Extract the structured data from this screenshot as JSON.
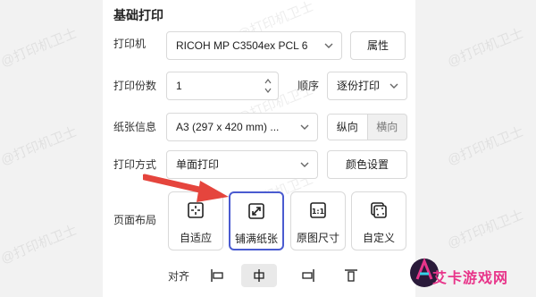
{
  "watermark": "@打印机卫士",
  "section_title": "基础打印",
  "printer": {
    "label": "打印机",
    "value": "RICOH MP C3504ex PCL 6",
    "props_button": "属性"
  },
  "copies": {
    "label": "打印份数",
    "value": "1",
    "order_label": "顺序",
    "order_value": "逐份打印"
  },
  "paper": {
    "label": "纸张信息",
    "value": "A3 (297 x 420 mm) ...",
    "orient_portrait": "纵向",
    "orient_landscape": "横向"
  },
  "mode": {
    "label": "打印方式",
    "value": "单面打印",
    "color_button": "颜色设置"
  },
  "layout": {
    "label": "页面布局",
    "options": [
      "自适应",
      "铺满纸张",
      "原图尺寸",
      "自定义"
    ],
    "selected": "铺满纸张",
    "original_size_glyph": "1:1"
  },
  "align": {
    "label": "对齐",
    "selected": "center"
  },
  "logo_text": "艾卡游戏网",
  "colors": {
    "accent": "#4a5bd0",
    "arrow": "#e5453d",
    "logo": "#e8358a"
  }
}
